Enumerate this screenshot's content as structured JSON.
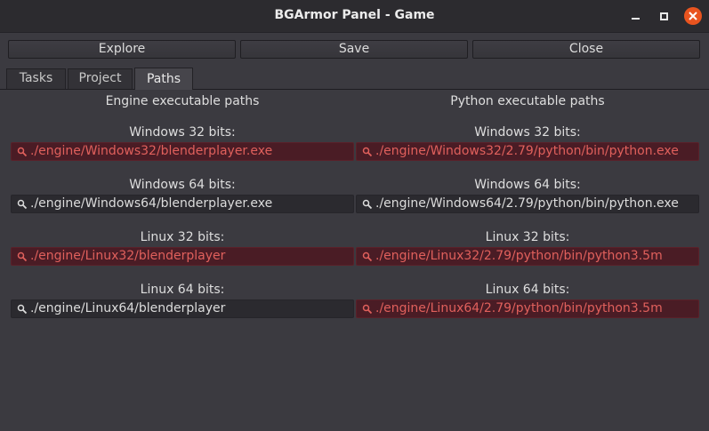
{
  "window": {
    "title": "BGArmor Panel - Game"
  },
  "toolbar": {
    "explore_label": "Explore",
    "save_label": "Save",
    "close_label": "Close"
  },
  "tabs": [
    {
      "label": "Tasks",
      "active": false
    },
    {
      "label": "Project",
      "active": false
    },
    {
      "label": "Paths",
      "active": true
    }
  ],
  "engine": {
    "heading": "Engine executable paths",
    "rows": [
      {
        "label": "Windows 32 bits:",
        "value": "./engine/Windows32/blenderplayer.exe",
        "valid": false
      },
      {
        "label": "Windows 64 bits:",
        "value": "./engine/Windows64/blenderplayer.exe",
        "valid": true
      },
      {
        "label": "Linux 32 bits:",
        "value": "./engine/Linux32/blenderplayer",
        "valid": false
      },
      {
        "label": "Linux 64 bits:",
        "value": "./engine/Linux64/blenderplayer",
        "valid": true
      }
    ]
  },
  "python": {
    "heading": "Python executable paths",
    "rows": [
      {
        "label": "Windows 32 bits:",
        "value": "./engine/Windows32/2.79/python/bin/python.exe",
        "valid": false
      },
      {
        "label": "Windows 64 bits:",
        "value": "./engine/Windows64/2.79/python/bin/python.exe",
        "valid": true
      },
      {
        "label": "Linux 32 bits:",
        "value": "./engine/Linux32/2.79/python/bin/python3.5m",
        "valid": false
      },
      {
        "label": "Linux 64 bits:",
        "value": "./engine/Linux64/2.79/python/bin/python3.5m",
        "valid": false
      }
    ]
  },
  "colors": {
    "background": "#3b3a40",
    "titlebar": "#2c2b2f",
    "close_button": "#e9541f",
    "error_field_bg": "#4a1c25",
    "error_text": "#e0605c"
  },
  "icons": {
    "minimize": "minimize-icon",
    "maximize": "maximize-icon",
    "close": "close-icon",
    "field": "search-icon"
  }
}
